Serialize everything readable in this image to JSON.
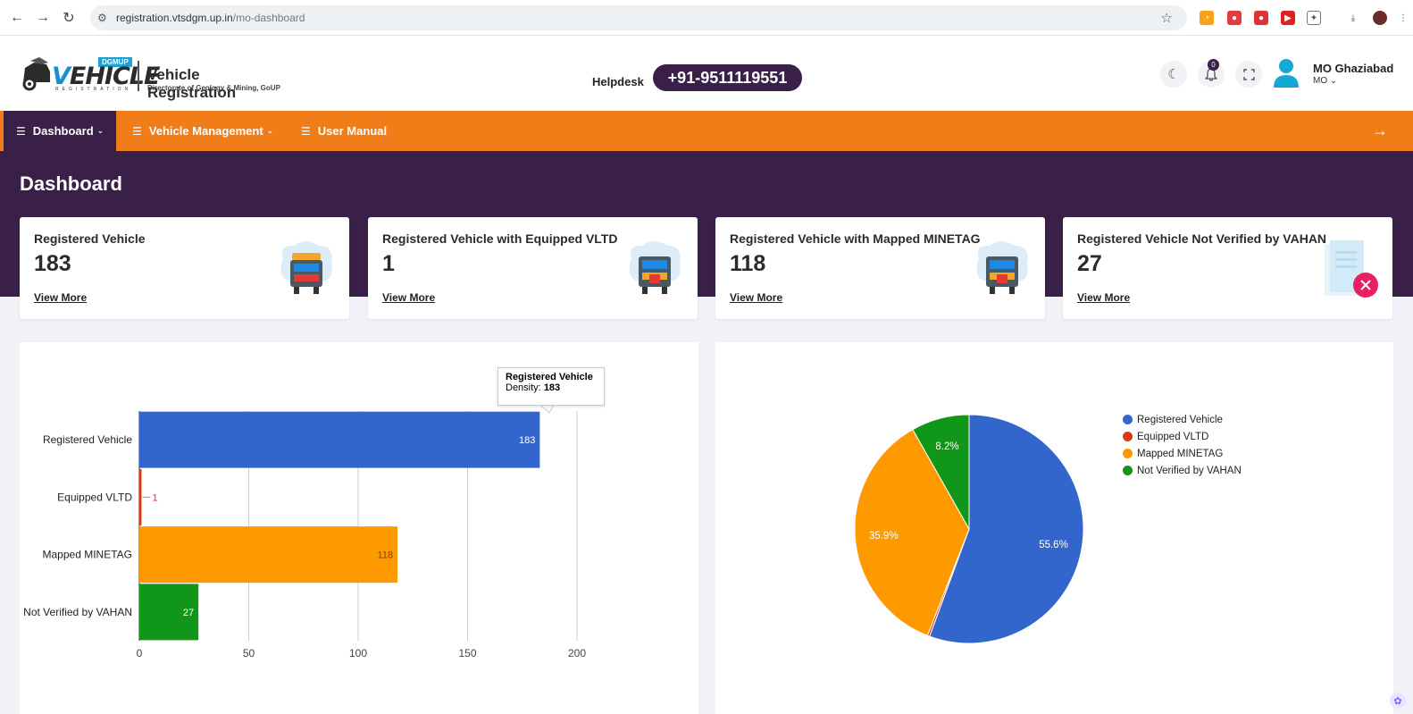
{
  "browser": {
    "url_host": "registration.vtsdgm.up.in",
    "url_path": "/mo-dashboard"
  },
  "header": {
    "logo_badge": "DGMUP",
    "logo_word_v": "V",
    "logo_word_rest": "EHICLE",
    "logo_small": "REGISTRATION",
    "title": "Vehicle Registration",
    "subtitle": "Directorate of Geology & Mining, GoUP",
    "helpdesk_label": "Helpdesk",
    "helpdesk_phone": "+91-9511119551",
    "notification_count": "0",
    "user_name": "MO Ghaziabad",
    "user_role": "MO"
  },
  "menu": {
    "items": [
      {
        "label": "Dashboard",
        "icon": "server-icon",
        "has_dropdown": true,
        "active": true
      },
      {
        "label": "Vehicle Management",
        "icon": "server-icon",
        "has_dropdown": true,
        "active": false
      },
      {
        "label": "User Manual",
        "icon": "server-icon",
        "has_dropdown": false,
        "active": false
      }
    ]
  },
  "page": {
    "title": "Dashboard"
  },
  "cards": [
    {
      "title": "Registered Vehicle",
      "value": "183",
      "link": "View More",
      "icon": "truck-illustration"
    },
    {
      "title": "Registered Vehicle with Equipped VLTD",
      "value": "1",
      "link": "View More",
      "icon": "truck-illustration"
    },
    {
      "title": "Registered Vehicle with Mapped MINETAG",
      "value": "118",
      "link": "View More",
      "icon": "truck-illustration"
    },
    {
      "title": "Registered Vehicle Not Verified by VAHAN",
      "value": "27",
      "link": "View More",
      "icon": "document-rejected-illustration"
    }
  ],
  "colors": {
    "purple": "#3a1f48",
    "orange": "#f07d18",
    "blue": "#3366cc",
    "red": "#dc3912",
    "amber": "#ff9900",
    "green": "#109618"
  },
  "tooltip": {
    "title": "Registered Vehicle",
    "label": "Density:",
    "value": "183"
  },
  "chart_data": [
    {
      "type": "bar",
      "orientation": "horizontal",
      "categories": [
        "Registered Vehicle",
        "Equipped VLTD",
        "Mapped MINETAG",
        "Not Verified by VAHAN"
      ],
      "values": [
        183,
        1,
        118,
        27
      ],
      "colors": [
        "#3366cc",
        "#dc3912",
        "#ff9900",
        "#109618"
      ],
      "xlim": [
        0,
        200
      ],
      "xticks": [
        0,
        50,
        100,
        150,
        200
      ],
      "grid": true
    },
    {
      "type": "pie",
      "labels": [
        "Registered Vehicle",
        "Equipped VLTD",
        "Mapped MINETAG",
        "Not Verified by VAHAN"
      ],
      "values": [
        183,
        1,
        118,
        27
      ],
      "slice_labels": [
        "55.6%",
        "",
        "35.9%",
        "8.2%"
      ],
      "colors": [
        "#3366cc",
        "#dc3912",
        "#ff9900",
        "#109618"
      ],
      "legend": "right"
    }
  ]
}
